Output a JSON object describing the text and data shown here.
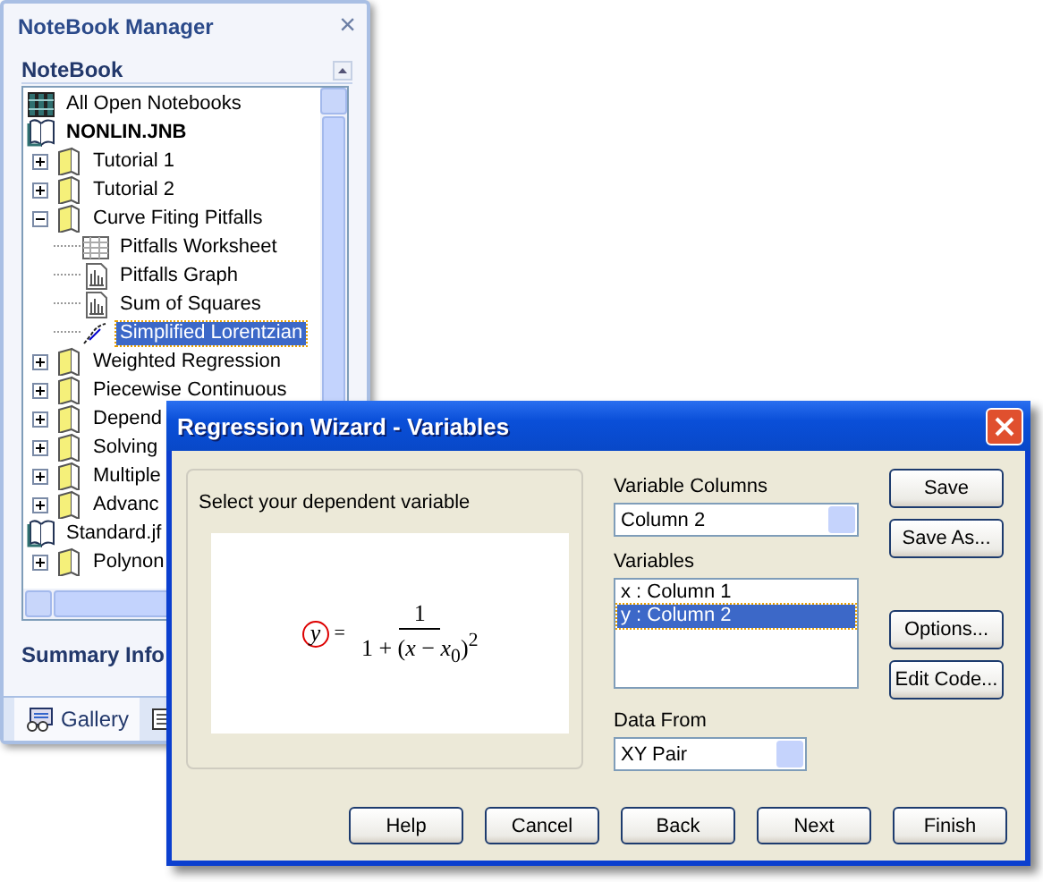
{
  "panel": {
    "title": "NoteBook Manager",
    "close": "×",
    "section": "NoteBook",
    "summary": "Summary Info",
    "tree": [
      {
        "label": "All Open Notebooks",
        "kind": "books",
        "bold": false,
        "selected": false
      },
      {
        "label": "NONLIN.JNB",
        "kind": "notebook",
        "bold": true,
        "selected": false,
        "children": [
          {
            "label": "Tutorial 1",
            "kind": "section",
            "expanded": false,
            "selected": false
          },
          {
            "label": "Tutorial 2",
            "kind": "section",
            "expanded": false,
            "selected": false
          },
          {
            "label": "Curve Fiting Pitfalls",
            "kind": "section",
            "expanded": true,
            "selected": false,
            "children": [
              {
                "label": "Pitfalls Worksheet",
                "kind": "worksheet",
                "selected": false
              },
              {
                "label": "Pitfalls Graph",
                "kind": "graph",
                "selected": false
              },
              {
                "label": "Sum of Squares",
                "kind": "graph",
                "selected": false
              },
              {
                "label": "Simplified Lorentzian",
                "kind": "equation",
                "selected": true
              }
            ]
          },
          {
            "label": "Weighted Regression",
            "kind": "section",
            "expanded": false,
            "selected": false
          },
          {
            "label": "Piecewise Continuous",
            "kind": "section",
            "expanded": false,
            "selected": false
          },
          {
            "label": "Depend",
            "kind": "section",
            "expanded": false,
            "selected": false
          },
          {
            "label": "Solving",
            "kind": "section",
            "expanded": false,
            "selected": false
          },
          {
            "label": "Multiple",
            "kind": "section",
            "expanded": false,
            "selected": false
          },
          {
            "label": "Advanc",
            "kind": "section",
            "expanded": false,
            "selected": false
          }
        ]
      },
      {
        "label": "Standard.jf",
        "kind": "notebook",
        "bold": false,
        "selected": false,
        "children": [
          {
            "label": "Polynon",
            "kind": "section",
            "expanded": false,
            "selected": false
          }
        ]
      }
    ],
    "tabs": [
      {
        "label": "Gallery",
        "kind": "gallery",
        "selected": true
      },
      {
        "kind": "list",
        "selected": false
      }
    ]
  },
  "dialog": {
    "title": "Regression Wizard - Variables",
    "prompt": "Select your dependent variable",
    "equation": {
      "lhs": "y",
      "equals": "=",
      "numerator": "1",
      "denominator": "1 + (*x* − *x*$_{0}$)$^{2}$"
    },
    "variable_columns": {
      "label": "Variable Columns",
      "value": "Column 2"
    },
    "variables": {
      "label": "Variables",
      "items": [
        {
          "text": "x : Column 1",
          "selected": false
        },
        {
          "text": "y : Column 2",
          "selected": true
        }
      ]
    },
    "data_from": {
      "label": "Data From",
      "value": "XY Pair"
    },
    "file_buttons": [
      "Save",
      "Save As..."
    ],
    "code_buttons": [
      "Options...",
      "Edit Code..."
    ],
    "nav_buttons": [
      "Help",
      "Cancel",
      "Back",
      "Next",
      "Finish"
    ]
  }
}
